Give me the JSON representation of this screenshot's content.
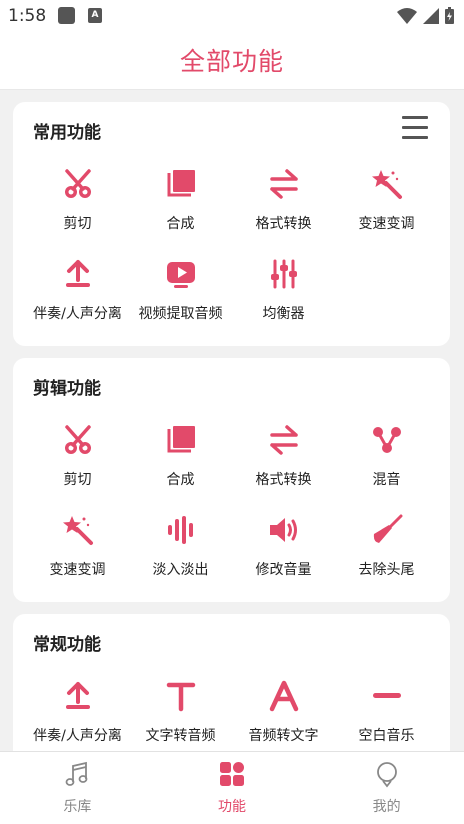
{
  "status_bar": {
    "time": "1:58",
    "notif_letter": "A"
  },
  "app": {
    "title": "全部功能",
    "accent": "#e24a6a"
  },
  "sections": [
    {
      "title": "常用功能",
      "has_menu": true,
      "items": [
        {
          "label": "剪切",
          "icon": "scissors-icon"
        },
        {
          "label": "合成",
          "icon": "merge-icon"
        },
        {
          "label": "格式转换",
          "icon": "convert-icon"
        },
        {
          "label": "变速变调",
          "icon": "magic-wand-icon"
        },
        {
          "label": "伴奏/人声分离",
          "icon": "upload-icon"
        },
        {
          "label": "视频提取音频",
          "icon": "video-icon"
        },
        {
          "label": "均衡器",
          "icon": "equalizer-icon"
        }
      ]
    },
    {
      "title": "剪辑功能",
      "has_menu": false,
      "items": [
        {
          "label": "剪切",
          "icon": "scissors-icon"
        },
        {
          "label": "合成",
          "icon": "merge-icon"
        },
        {
          "label": "格式转换",
          "icon": "convert-icon"
        },
        {
          "label": "混音",
          "icon": "mix-icon"
        },
        {
          "label": "变速变调",
          "icon": "magic-wand-icon"
        },
        {
          "label": "淡入淡出",
          "icon": "fade-icon"
        },
        {
          "label": "修改音量",
          "icon": "volume-icon"
        },
        {
          "label": "去除头尾",
          "icon": "trowel-icon"
        }
      ]
    },
    {
      "title": "常规功能",
      "has_menu": false,
      "items": [
        {
          "label": "伴奏/人声分离",
          "icon": "upload-icon"
        },
        {
          "label": "文字转音频",
          "icon": "text-t-icon"
        },
        {
          "label": "音频转文字",
          "icon": "text-a-icon"
        },
        {
          "label": "空白音乐",
          "icon": "minus-icon"
        }
      ]
    }
  ],
  "nav": [
    {
      "label": "乐库",
      "icon": "music-note-icon",
      "active": false
    },
    {
      "label": "功能",
      "icon": "grid-icon",
      "active": true
    },
    {
      "label": "我的",
      "icon": "profile-icon",
      "active": false
    }
  ]
}
